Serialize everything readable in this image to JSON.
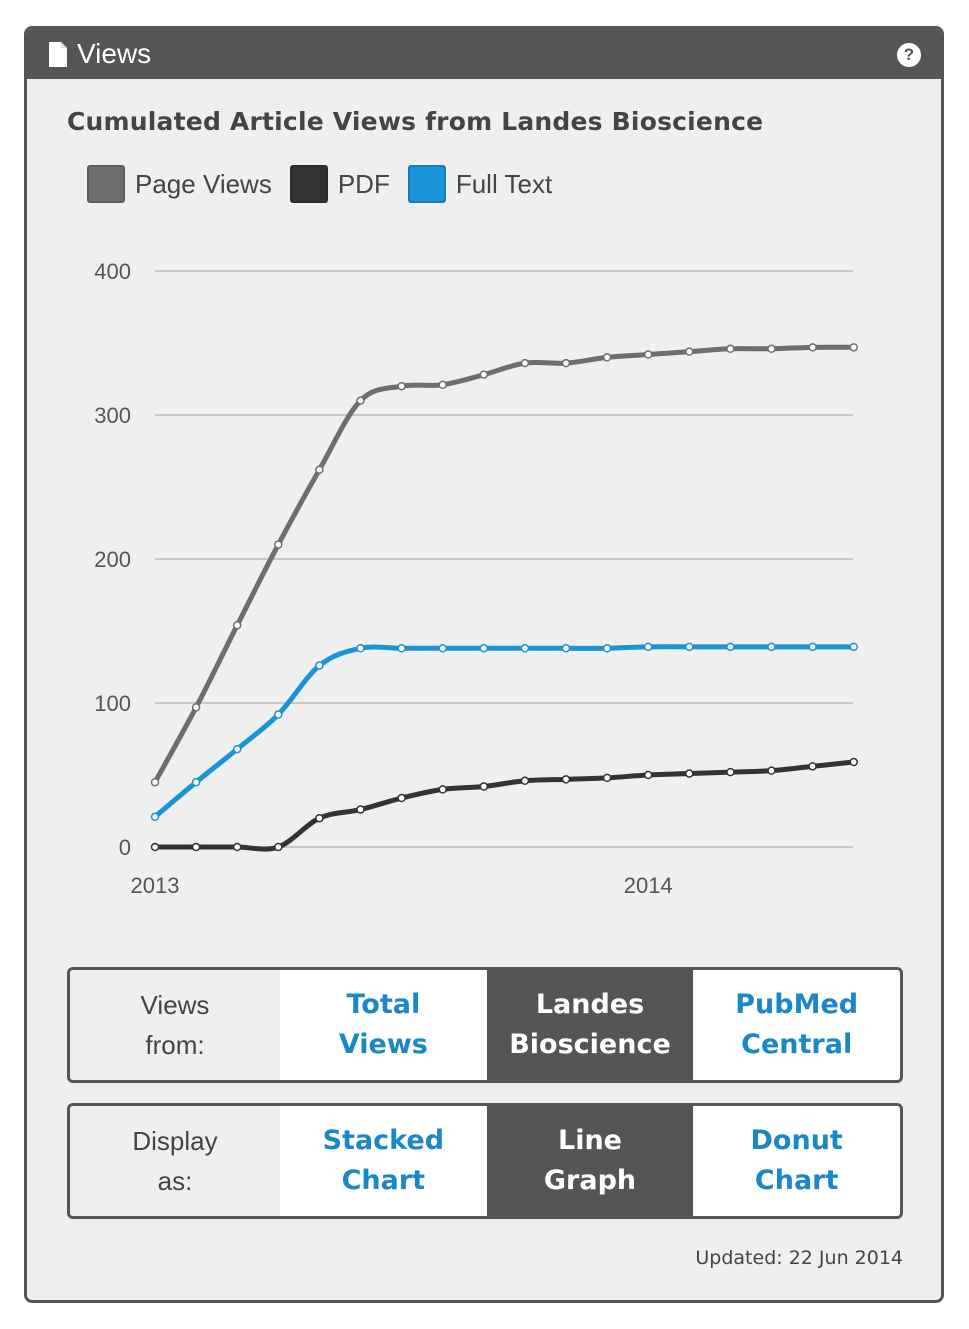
{
  "panel": {
    "title": "Views",
    "help_icon": "question-circle-icon",
    "doc_icon": "document-icon"
  },
  "chart_title": "Cumulated Article Views from Landes Bioscience",
  "legend": [
    {
      "label": "Page Views",
      "color": "#6e6e6e"
    },
    {
      "label": "PDF",
      "color": "#333333"
    },
    {
      "label": "Full Text",
      "color": "#1a94d6"
    }
  ],
  "chart_data": {
    "type": "line",
    "title": "Cumulated Article Views from Landes Bioscience",
    "xlabel": "",
    "ylabel": "",
    "ylim": [
      0,
      400
    ],
    "yticks": [
      "0",
      "100",
      "200",
      "300",
      "400"
    ],
    "xticks": [
      {
        "label": "2013",
        "index": 0
      },
      {
        "label": "2014",
        "index": 12
      }
    ],
    "grid": true,
    "legend_position": "top-left",
    "x": [
      "2013-06",
      "2013-07",
      "2013-08",
      "2013-09",
      "2013-10",
      "2013-11",
      "2013-12",
      "2014-01",
      "2014-02",
      "2014-03",
      "2014-04",
      "2014-05",
      "2014-06",
      "2014-07",
      "2014-08",
      "2014-09",
      "2014-10",
      "2014-11"
    ],
    "series": [
      {
        "name": "Page Views",
        "color": "#6e6e6e",
        "values": [
          45,
          97,
          154,
          210,
          262,
          310,
          320,
          321,
          328,
          336,
          336,
          340,
          342,
          344,
          346,
          346,
          347,
          347
        ]
      },
      {
        "name": "PDF",
        "color": "#333333",
        "values": [
          0,
          0,
          0,
          0,
          20,
          26,
          34,
          40,
          42,
          46,
          47,
          48,
          50,
          51,
          52,
          53,
          56,
          59
        ]
      },
      {
        "name": "Full Text",
        "color": "#1a94d6",
        "values": [
          21,
          45,
          68,
          92,
          126,
          138,
          138,
          138,
          138,
          138,
          138,
          138,
          139,
          139,
          139,
          139,
          139,
          139
        ]
      }
    ]
  },
  "views_from": {
    "label": "Views\nfrom:",
    "options": [
      "Total\nViews",
      "Landes\nBioscience",
      "PubMed\nCentral"
    ],
    "selected": "Landes\nBioscience"
  },
  "display_as": {
    "label": "Display\nas:",
    "options": [
      "Stacked\nChart",
      "Line\nGraph",
      "Donut\nChart"
    ],
    "selected": "Line\nGraph"
  },
  "updated": "Updated: 22 Jun 2014"
}
